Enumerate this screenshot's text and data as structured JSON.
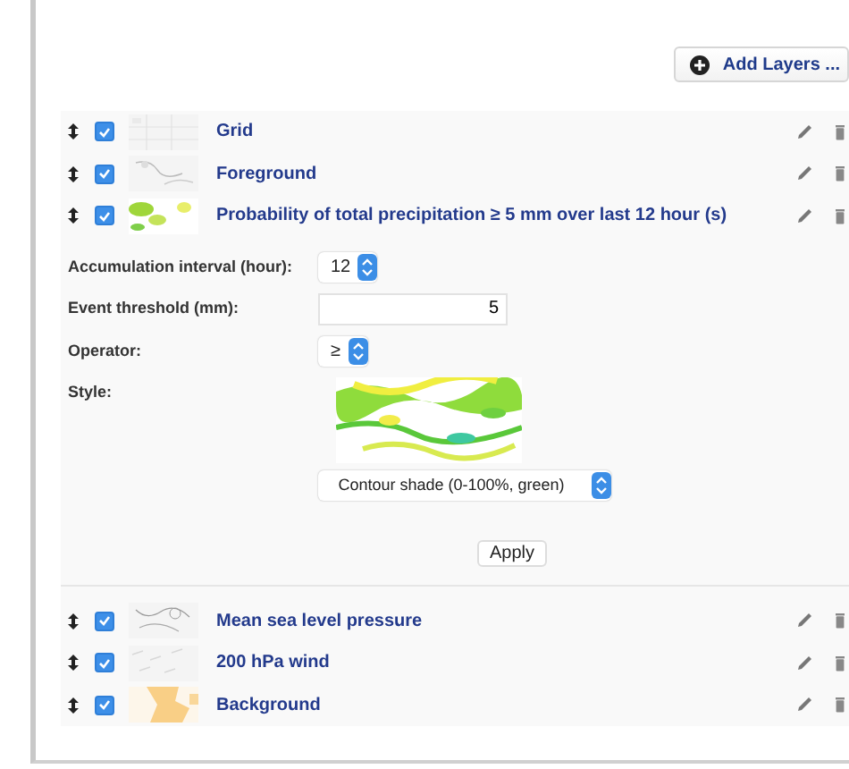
{
  "toolbar": {
    "add_button": "Add Layers ..."
  },
  "layers": [
    {
      "name": "Grid",
      "checked": true
    },
    {
      "name": "Foreground",
      "checked": true
    },
    {
      "name": "Probability of total precipitation ≥ 5 mm over last 12 hour (s)",
      "checked": true,
      "settings": {
        "fields": [
          {
            "kind": "select",
            "label": "Accumulation interval (hour):",
            "value": "12"
          },
          {
            "kind": "input",
            "label": "Event threshold (mm):",
            "value": "5"
          },
          {
            "kind": "select",
            "label": "Operator:",
            "value": "≥"
          },
          {
            "kind": "style",
            "label": "Style:",
            "value": "Contour shade (0-100%, green)"
          }
        ],
        "apply": "Apply"
      }
    },
    {
      "name": "Mean sea level pressure",
      "checked": true
    },
    {
      "name": "200 hPa wind",
      "checked": true
    },
    {
      "name": "Background",
      "checked": true
    }
  ]
}
